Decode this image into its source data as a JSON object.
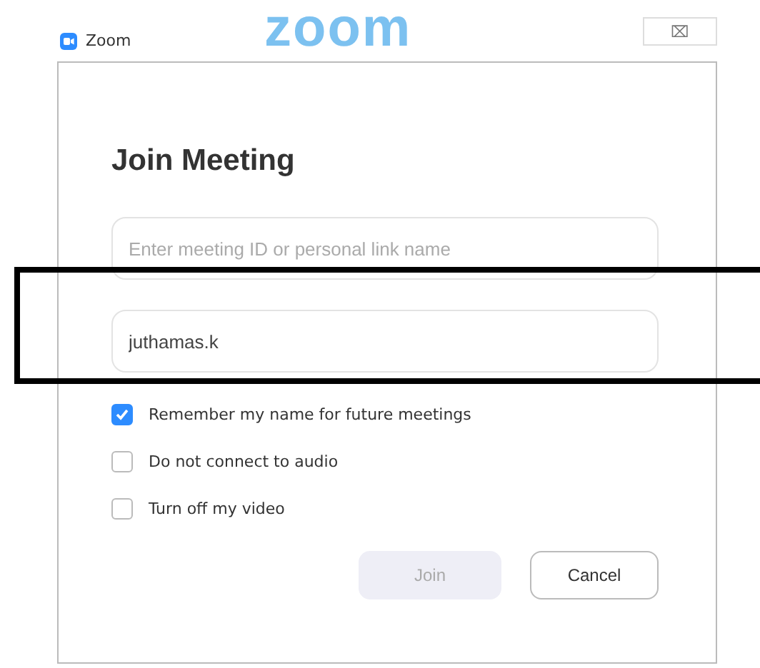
{
  "window": {
    "title": "Zoom",
    "logo_text": "zoom",
    "close": "⌧"
  },
  "heading": "Join Meeting",
  "fields": [
    {
      "placeholder": "Enter meeting ID or personal link name"
    },
    {
      "value": "juthamas.k",
      "highlighted": true
    }
  ],
  "options": [
    {
      "label": "Remember my name for future meetings",
      "checked": true
    },
    {
      "label": "Do not connect to audio",
      "checked": false
    },
    {
      "label": "Turn off my video",
      "checked": false
    }
  ],
  "buttons": [
    {
      "label": "Join",
      "disabled": true
    },
    {
      "label": "Cancel",
      "disabled": false
    }
  ]
}
